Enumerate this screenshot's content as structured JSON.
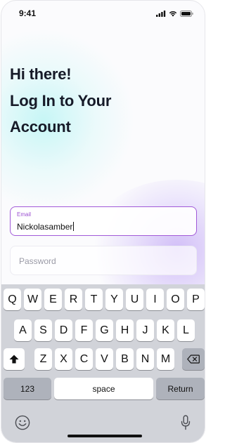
{
  "status_bar": {
    "time": "9:41"
  },
  "heading": {
    "line1": "Hi there!",
    "line2": "Log In to Your",
    "line3": "Account"
  },
  "email": {
    "label": "Email",
    "value": "Nickolasamber"
  },
  "password": {
    "placeholder": "Password"
  },
  "keyboard": {
    "row1": [
      "Q",
      "W",
      "E",
      "R",
      "T",
      "Y",
      "U",
      "I",
      "O",
      "P"
    ],
    "row2": [
      "A",
      "S",
      "D",
      "F",
      "G",
      "H",
      "J",
      "K",
      "L"
    ],
    "row3": [
      "Z",
      "X",
      "C",
      "V",
      "B",
      "N",
      "M"
    ],
    "numbers_label": "123",
    "space_label": "space",
    "return_label": "Return"
  },
  "colors": {
    "accent": "#a15ad8",
    "heading": "#161a28",
    "keyboard_bg": "#d1d3d9",
    "function_key": "#aeb2bb"
  },
  "icons": {
    "status": [
      "signal-icon",
      "wifi-icon",
      "battery-icon"
    ],
    "keyboard": [
      "shift-icon",
      "delete-icon",
      "emoji-icon",
      "microphone-icon"
    ]
  }
}
